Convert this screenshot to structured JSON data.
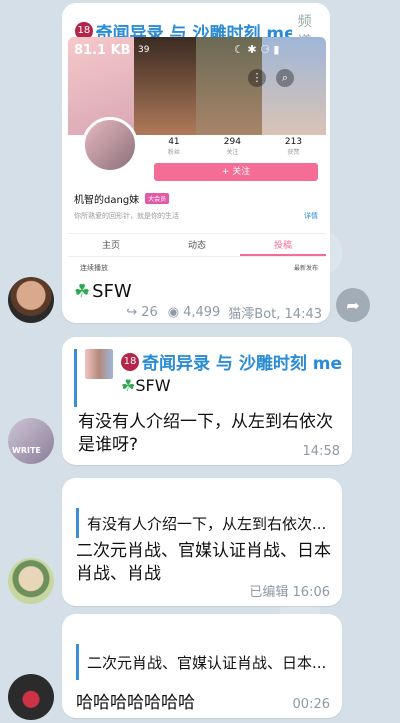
{
  "bubble1": {
    "channel_title": "奇闻异录 与 沙雕时刻 me...",
    "channel_label": "频道",
    "channel_badge": "18",
    "preview": {
      "status_left": "81.1 KB",
      "status_extra": "39",
      "stats": [
        {
          "value": "41",
          "label": "粉丝"
        },
        {
          "value": "294",
          "label": "关注"
        },
        {
          "value": "213",
          "label": "获赞"
        }
      ],
      "follow_label": "+ 关注",
      "username": "机智的dang妹",
      "member_tag": "大会员",
      "bio": "你所熟爱的回形针，就是你的生活",
      "detail_link": "详情",
      "tabs": [
        "主页",
        "动态",
        "投稿"
      ],
      "bottom_left": "连续播放",
      "bottom_right": "最新发布"
    },
    "text": "SFW",
    "forwards": "26",
    "views": "4,499",
    "footer": "猫澪Bot, 14:43"
  },
  "bubble2": {
    "reply_title": "奇闻异录 与 沙雕时刻 me...",
    "reply_badge": "18",
    "reply_text": "SFW",
    "text": "有没有人介绍一下，从左到右依次是谁呀?",
    "time": "14:58",
    "avatar_text": "WRITE"
  },
  "bubble3": {
    "reply_text": "有没有人介绍一下，从左到右依次...",
    "text": "二次元肖战、官媒认证肖战、日本肖战、肖战",
    "footer": "已编辑 16:06"
  },
  "bubble4": {
    "reply_text": "二次元肖战、官媒认证肖战、日本...",
    "text": "哈哈哈哈哈哈哈",
    "time": "00:26"
  }
}
